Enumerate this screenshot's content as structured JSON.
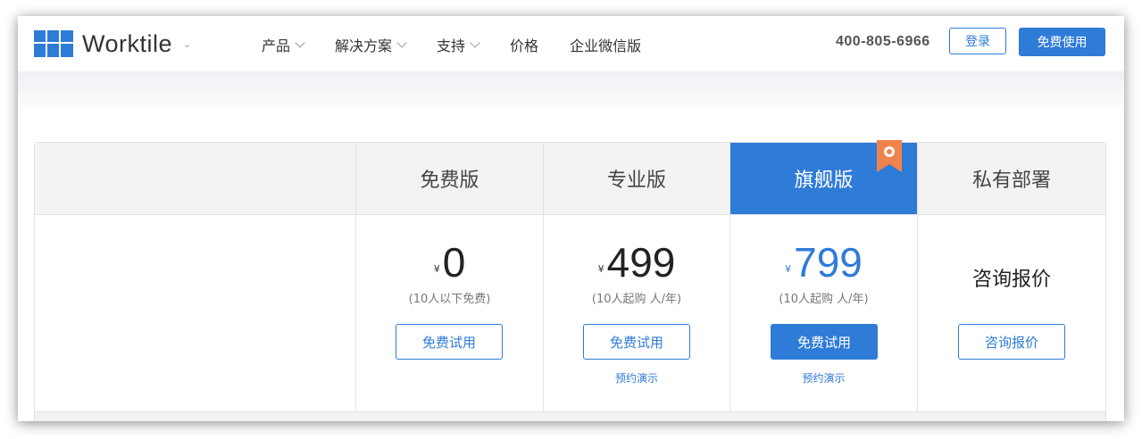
{
  "header": {
    "brand": "Worktile",
    "nav": [
      {
        "label": "产品",
        "has_dropdown": true
      },
      {
        "label": "解决方案",
        "has_dropdown": true
      },
      {
        "label": "支持",
        "has_dropdown": true
      },
      {
        "label": "价格",
        "has_dropdown": false
      },
      {
        "label": "企业微信版",
        "has_dropdown": false
      }
    ],
    "phone": "400-805-6966",
    "login_label": "登录",
    "signup_label": "免费使用"
  },
  "plans": [
    {
      "name": "免费版",
      "currency": "¥",
      "price": "0",
      "note": "(10人以下免费)",
      "button": "免费试用",
      "demo": ""
    },
    {
      "name": "专业版",
      "currency": "¥",
      "price": "499",
      "note": "(10人起购 人/年)",
      "button": "免费试用",
      "demo": "预约演示"
    },
    {
      "name": "旗舰版",
      "currency": "¥",
      "price": "799",
      "note": "(10人起购 人/年)",
      "button": "免费试用",
      "demo": "预约演示",
      "highlighted": true
    },
    {
      "name": "私有部署",
      "quote": "咨询报价",
      "button": "咨询报价"
    }
  ],
  "colors": {
    "accent": "#2f7bd8",
    "ribbon": "#f0834a",
    "header_bg": "#f3f3f3"
  }
}
